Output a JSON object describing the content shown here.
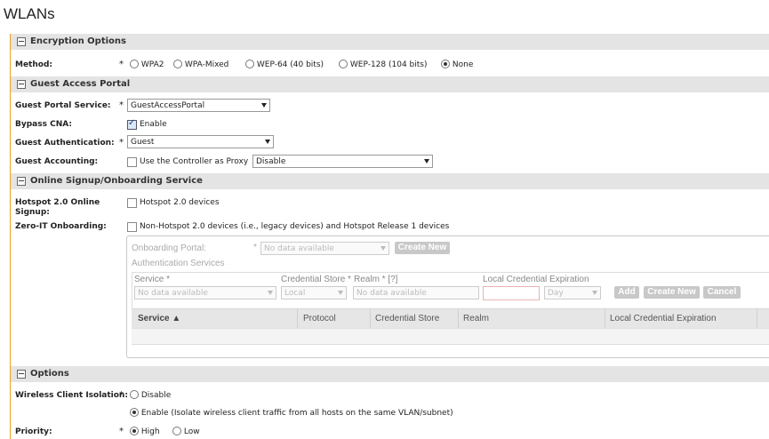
{
  "page_title": "WLANs",
  "sections": {
    "encryption": "Encryption Options",
    "guest_access": "Guest Access Portal",
    "online_signup": "Online Signup/Onboarding Service",
    "options": "Options"
  },
  "encryption": {
    "method_label": "Method:",
    "required": "*",
    "options": [
      "WPA2",
      "WPA-Mixed",
      "WEP-64 (40 bits)",
      "WEP-128 (104 bits)",
      "None"
    ],
    "selected": "None"
  },
  "guest": {
    "portal_service_label": "Guest Portal Service:",
    "portal_service_value": "GuestAccessPortal",
    "bypass_cna_label": "Bypass CNA:",
    "bypass_cna_checkbox": "Enable",
    "auth_label": "Guest Authentication:",
    "auth_value": "Guest",
    "accounting_label": "Guest Accounting:",
    "accounting_checkbox": "Use the Controller as Proxy",
    "accounting_value": "Disable",
    "required": "*"
  },
  "signup": {
    "hotspot_label_1": "Hotspot 2.0 Online",
    "hotspot_label_2": "Signup:",
    "hotspot_checkbox": "Hotspot 2.0 devices",
    "zeroit_label": "Zero-IT Onboarding:",
    "zeroit_checkbox": "Non-Hotspot 2.0 devices (i.e., legacy devices) and Hotspot Release 1 devices",
    "onboarding_portal_label": "Onboarding Portal:",
    "required": "*",
    "onboarding_portal_value": "No data available",
    "create_new": "Create New",
    "auth_services_label": "Authentication Services",
    "service_label": "Service *",
    "service_value": "No data available",
    "cred_store_label": "Credential Store *",
    "cred_store_value": "Local",
    "realm_label": "Realm * [?]",
    "realm_value": "No data available",
    "lce_label": "Local Credential Expiration",
    "lce_unit": "Day",
    "add": "Add",
    "create_new_2": "Create New",
    "cancel": "Cancel",
    "grid_columns": [
      "Service ▲",
      "Protocol",
      "Credential Store",
      "Realm",
      "Local Credential Expiration"
    ]
  },
  "options": {
    "isolation_label": "Wireless Client Isolation:",
    "required": "*",
    "isolation_disable": "Disable",
    "isolation_enable": "Enable (Isolate wireless client traffic from all hosts on the same VLAN/subnet)",
    "priority_label": "Priority:",
    "priority_high": "High",
    "priority_low": "Low"
  }
}
